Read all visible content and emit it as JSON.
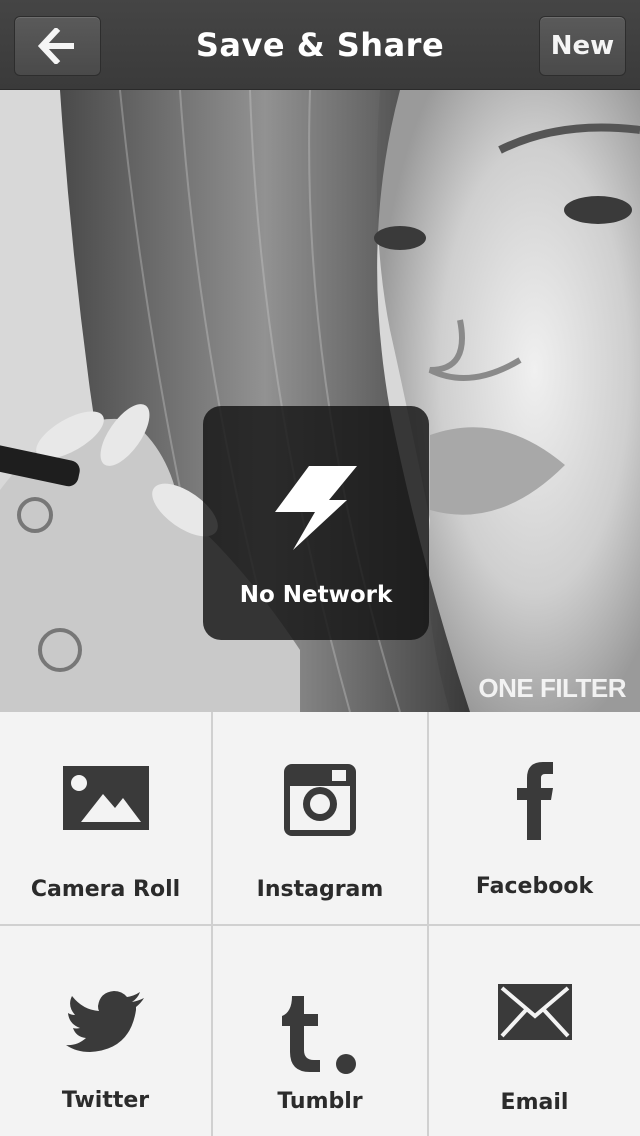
{
  "navbar": {
    "title": "Save & Share",
    "back_icon": "arrow-left-icon",
    "new_label": "New"
  },
  "photo": {
    "watermark": "ONE FILTER"
  },
  "toast": {
    "icon": "lightning-bolt-icon",
    "label": "No Network"
  },
  "share": {
    "items": [
      {
        "label": "Camera Roll",
        "icon": "image-icon"
      },
      {
        "label": "Instagram",
        "icon": "instagram-icon"
      },
      {
        "label": "Facebook",
        "icon": "facebook-icon"
      },
      {
        "label": "Twitter",
        "icon": "twitter-bird-icon"
      },
      {
        "label": "Tumblr",
        "icon": "tumblr-icon"
      },
      {
        "label": "Email",
        "icon": "envelope-icon"
      }
    ]
  },
  "colors": {
    "navbar_bg": "#3f3f3f",
    "grid_bg": "#f3f3f3",
    "icon": "#3a3a3a",
    "toast_bg": "#141414"
  }
}
